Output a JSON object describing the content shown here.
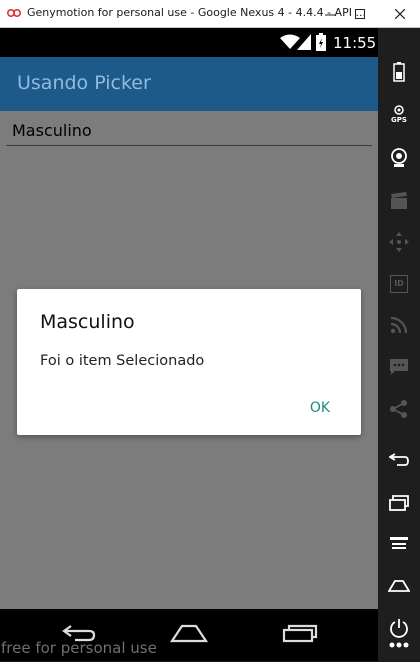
{
  "window": {
    "title": "Genymotion for personal use - Google Nexus 4 - 4.4.4 - API ...",
    "min_icon": "minimize-icon",
    "max_icon": "maximize-icon",
    "close_icon": "close-icon"
  },
  "statusbar": {
    "time": "11:55",
    "icons": [
      "wifi-icon",
      "signal-icon",
      "battery-icon"
    ]
  },
  "app": {
    "title": "Usando Picker",
    "picker_value": "Masculino"
  },
  "dialog": {
    "title": "Masculino",
    "message": "Foi o item Selecionado",
    "ok_label": "OK"
  },
  "navbar": {
    "watermark": "free for personal use",
    "buttons": [
      "back-icon",
      "home-icon",
      "recent-apps-icon"
    ]
  },
  "toolbar": {
    "gps_label": "GPS",
    "id_label": "ID",
    "items": [
      "battery-icon",
      "gps-icon",
      "camera-icon",
      "video-icon",
      "dpad-icon",
      "id-icon",
      "rss-icon",
      "sms-icon",
      "share-icon",
      "back-icon",
      "recent-apps-icon",
      "menu-icon",
      "home-icon",
      "power-icon",
      "more-icon"
    ]
  },
  "colors": {
    "app_bar": "#1d5a8a",
    "app_title": "#8fbbe0",
    "screen_dim": "#7c7c7c",
    "dialog_button": "#1e8a8a",
    "toolbar_bg": "#1e1e1e"
  }
}
